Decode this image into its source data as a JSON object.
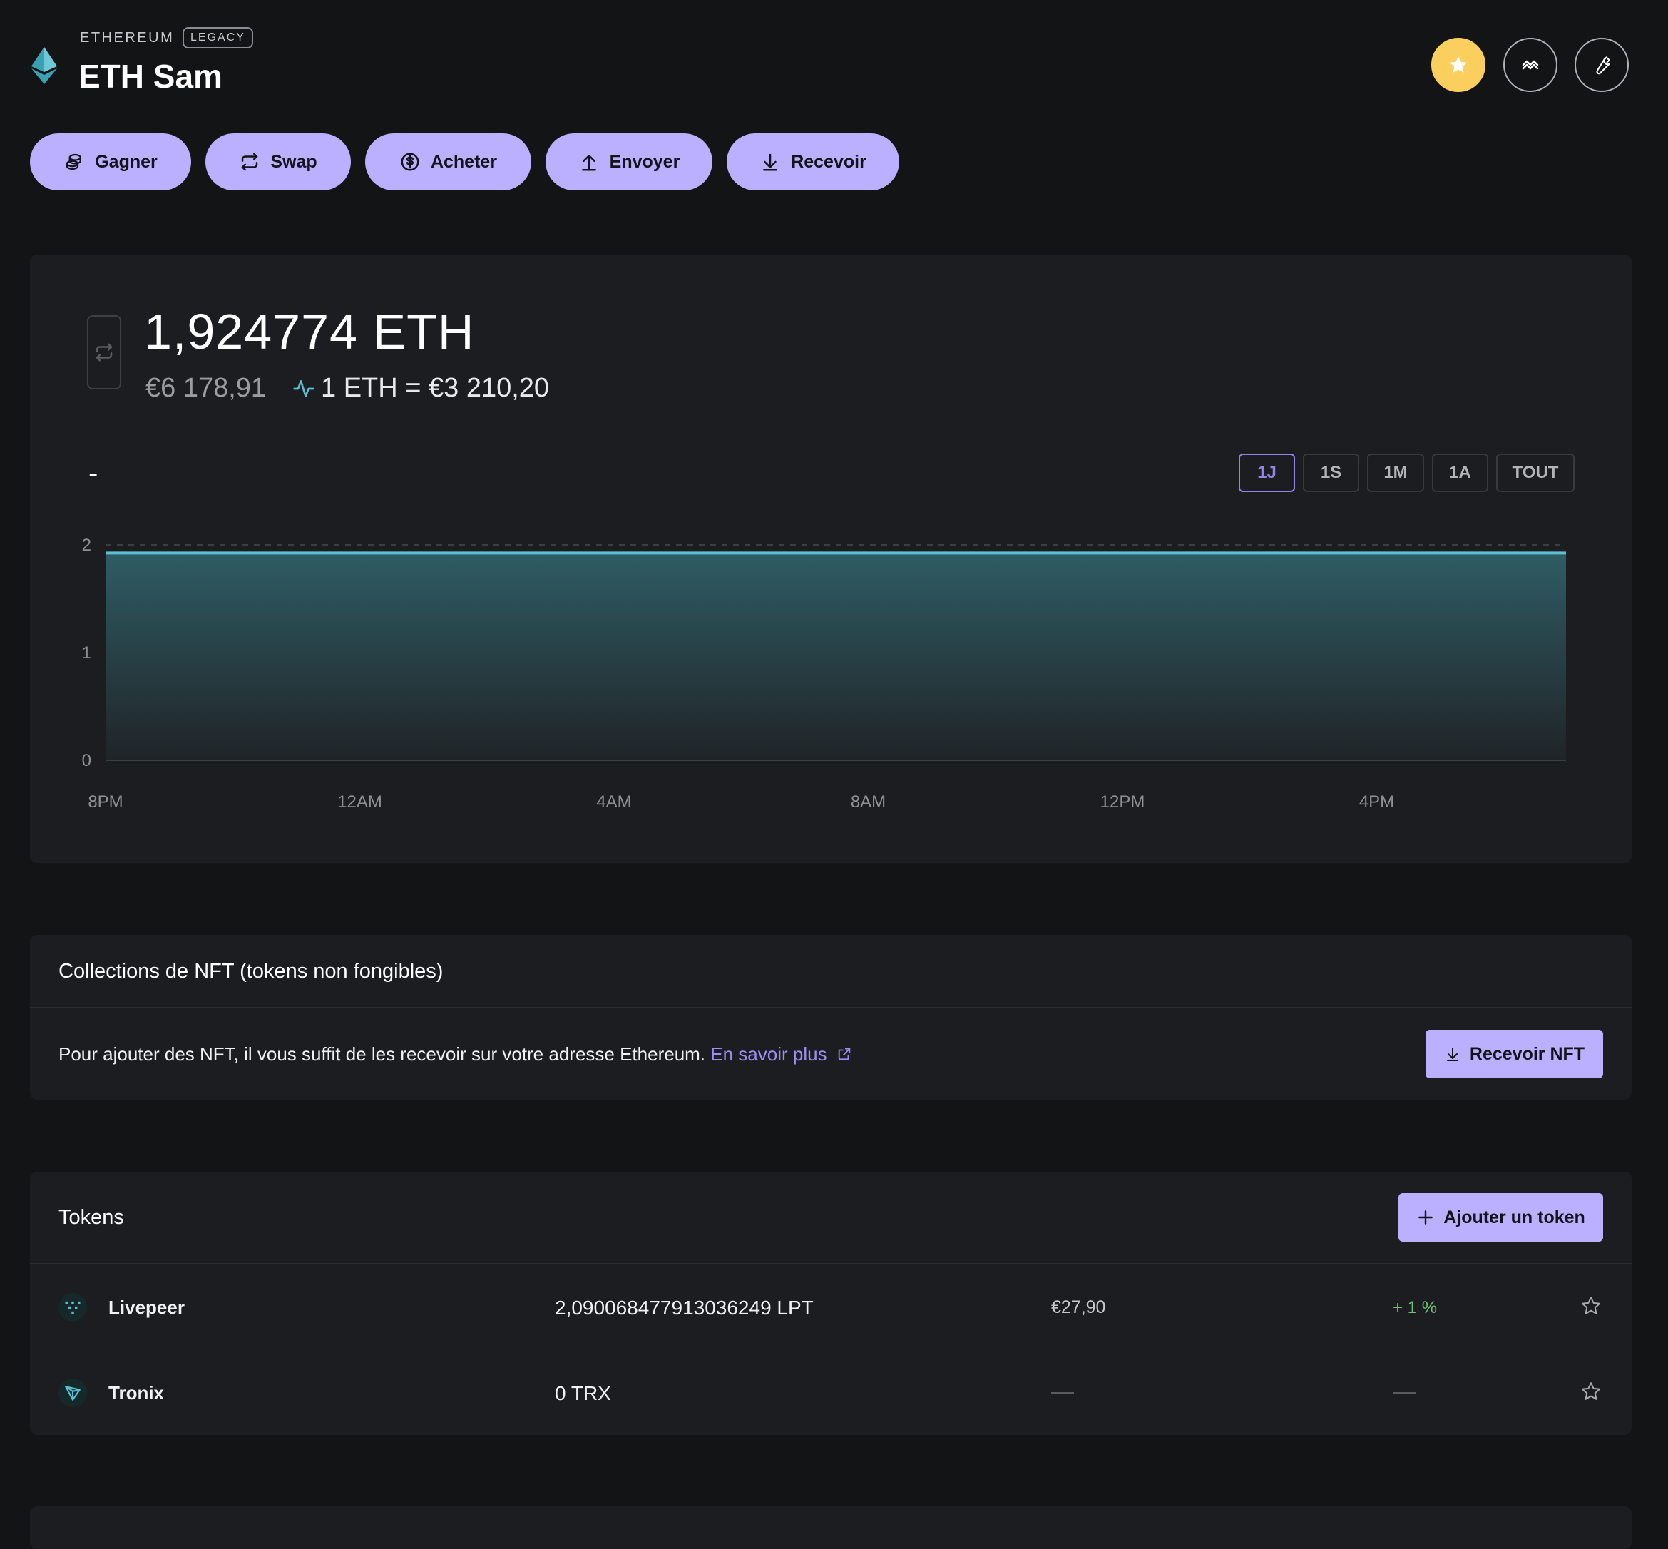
{
  "header": {
    "network": "ETHEREUM",
    "badge": "LEGACY",
    "account_name": "ETH Sam"
  },
  "actions": [
    {
      "label": "Gagner",
      "icon": "coins-icon"
    },
    {
      "label": "Swap",
      "icon": "swap-arrows-icon"
    },
    {
      "label": "Acheter",
      "icon": "dollar-circle-icon"
    },
    {
      "label": "Envoyer",
      "icon": "upload-arrow-icon"
    },
    {
      "label": "Recevoir",
      "icon": "download-arrow-icon"
    }
  ],
  "balance": {
    "amount": "1,924774 ETH",
    "fiat": "€6 178,91",
    "rate": "1 ETH = €3 210,20",
    "change_label": "-"
  },
  "ranges": {
    "day": "1J",
    "week": "1S",
    "month": "1M",
    "year": "1A",
    "all": "TOUT",
    "selected": "1J"
  },
  "chart_data": {
    "type": "area",
    "x": [
      "8PM",
      "12AM",
      "4AM",
      "8AM",
      "12PM",
      "4PM"
    ],
    "y_ticks": [
      0,
      1,
      2
    ],
    "ylim": [
      0,
      2
    ],
    "values": [
      1.924774,
      1.924774,
      1.924774,
      1.924774,
      1.924774,
      1.924774,
      1.924774
    ],
    "grid": true,
    "line_color": "#5bbfd1"
  },
  "nft": {
    "title": "Collections de NFT (tokens non fongibles)",
    "text": "Pour ajouter des NFT, il vous suffit de les recevoir sur votre adresse Ethereum.",
    "link": "En savoir plus",
    "button": "Recevoir NFT"
  },
  "tokens": {
    "title": "Tokens",
    "add_button": "Ajouter un token",
    "rows": [
      {
        "name": "Livepeer",
        "amount": "2,090068477913036249 LPT",
        "value": "€27,90",
        "change": "+ 1 %",
        "icon": "livepeer-icon"
      },
      {
        "name": "Tronix",
        "amount": "0 TRX",
        "value": "",
        "change": "",
        "icon": "tronix-icon"
      }
    ]
  },
  "colors": {
    "accent": "#bbb0ff",
    "star": "#fbcf5e",
    "positive": "#6cc36c",
    "link": "#9b8ff5"
  }
}
